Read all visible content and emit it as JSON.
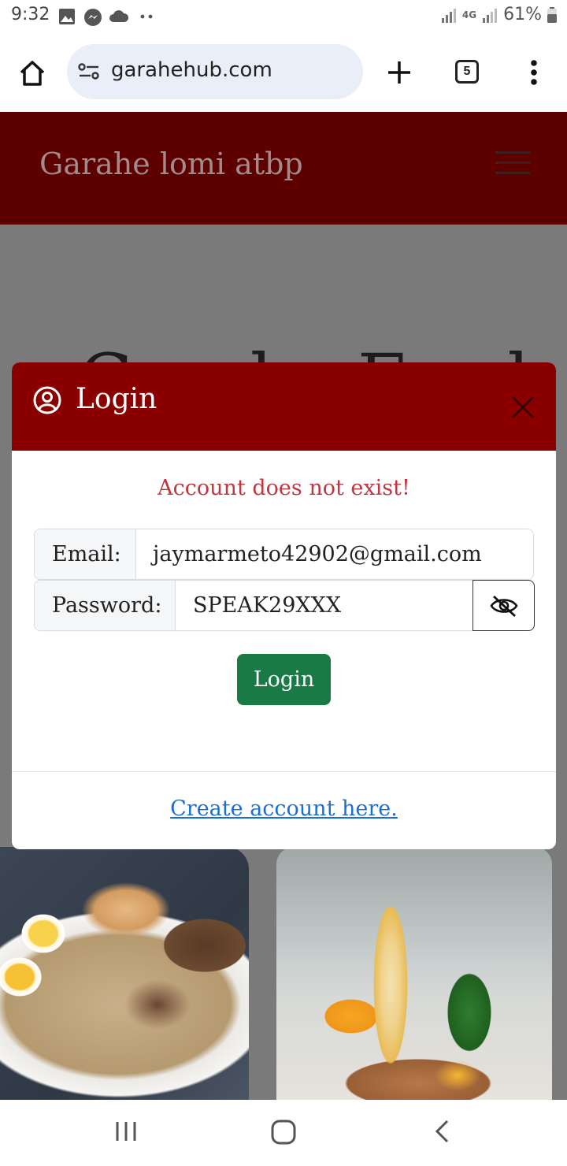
{
  "status_bar": {
    "time": "9:32",
    "network": "4G",
    "battery": "61%",
    "left_icons": [
      "image-icon",
      "messenger-icon",
      "cloud-icon",
      "more-dots-icon"
    ]
  },
  "browser": {
    "url": "garahehub.com",
    "tab_count": "5",
    "icons": [
      "home-icon",
      "site-settings-icon",
      "new-tab-icon",
      "tabs-icon",
      "menu-icon"
    ]
  },
  "site": {
    "title": "Garahe lomi atbp",
    "hero_partial": "Garahe Food"
  },
  "modal": {
    "title": "Login",
    "error": "Account does not exist!",
    "email_label": "Email:",
    "email_value": "jaymarmeto42902@gmail.com",
    "password_label": "Password:",
    "password_value": "SPEAK29XXX",
    "login_button": "Login",
    "create_link": "Create account here."
  },
  "colors": {
    "header_bg": "#5c0000",
    "modal_header_bg": "#8a0000",
    "error_text": "#c0363f",
    "login_button_bg": "#1a7a45",
    "link": "#1a6fd6"
  }
}
